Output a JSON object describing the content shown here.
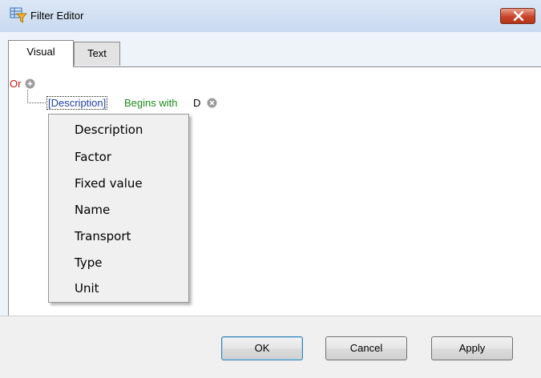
{
  "window": {
    "title": "Filter Editor",
    "title_icon": "filter-editor-icon",
    "close_icon": "close-icon"
  },
  "tabs": [
    {
      "label": "Visual",
      "active": true
    },
    {
      "label": "Text",
      "active": false
    }
  ],
  "filter": {
    "group_operator": "Or",
    "add_icon": "plus-circle-icon",
    "condition": {
      "field": "[Description]",
      "operator": "Begins with",
      "value": "D",
      "remove_icon": "x-circle-icon"
    }
  },
  "field_menu": {
    "items": [
      "Description",
      "Factor",
      "Fixed value",
      "Name",
      "Transport",
      "Type",
      "Unit"
    ]
  },
  "buttons": {
    "ok": "OK",
    "cancel": "Cancel",
    "apply": "Apply"
  },
  "colors": {
    "group_operator": "#c0180c",
    "field": "#1f3fa8",
    "operator": "#1c8a1c",
    "close_button": "#c7442a"
  }
}
